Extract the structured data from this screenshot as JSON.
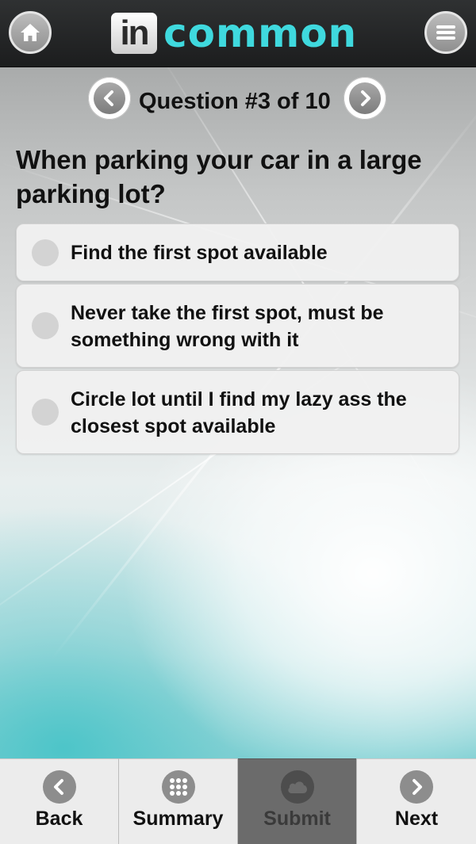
{
  "app": {
    "logo_mark": "in",
    "logo_text": "common",
    "icons": {
      "home": "home-icon",
      "menu": "menu-icon"
    },
    "colors": {
      "brand_cyan": "#3fd9de",
      "topbar": "#1f2021",
      "tab_active_bg": "#6b6b6b"
    }
  },
  "quiz": {
    "counter": "Question #3 of 10",
    "question": "When parking your car in a large parking lot?",
    "options": [
      {
        "label": "Find the first spot available",
        "selected": false
      },
      {
        "label": "Never take the first spot, must be something wrong with it",
        "selected": false
      },
      {
        "label": "Circle lot until I find my lazy ass the closest spot available",
        "selected": false
      }
    ]
  },
  "tabs": [
    {
      "label": "Back",
      "icon": "chevron-left-icon"
    },
    {
      "label": "Summary",
      "icon": "grid-icon"
    },
    {
      "label": "Submit",
      "icon": "cloud-icon",
      "state": "disabled"
    },
    {
      "label": "Next",
      "icon": "chevron-right-icon"
    }
  ]
}
